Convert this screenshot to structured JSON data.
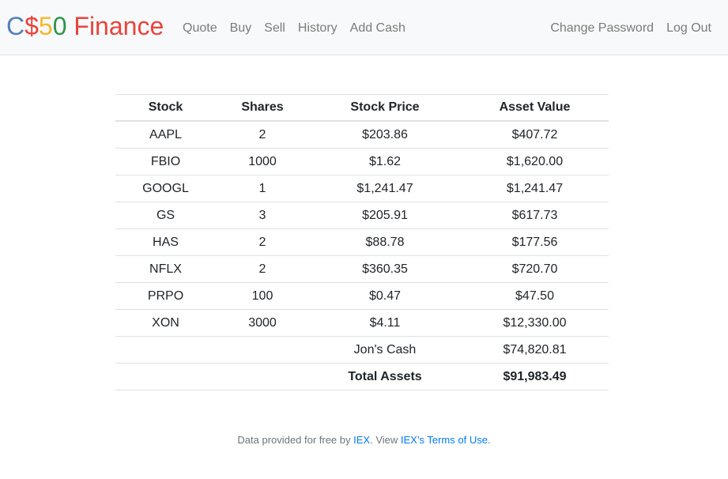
{
  "brand": {
    "parts": [
      {
        "text": "C",
        "color": "#537fbe"
      },
      {
        "text": "$",
        "color": "#ea433b"
      },
      {
        "text": "5",
        "color": "#f5b82e"
      },
      {
        "text": "0",
        "color": "#2e944b"
      },
      {
        "text": " Finance",
        "color": "#ea433b"
      }
    ]
  },
  "nav": {
    "left": [
      "Quote",
      "Buy",
      "Sell",
      "History",
      "Add Cash"
    ],
    "right": [
      "Change Password",
      "Log Out"
    ]
  },
  "table": {
    "headers": [
      "Stock",
      "Shares",
      "Stock Price",
      "Asset Value"
    ],
    "rows": [
      [
        "AAPL",
        "2",
        "$203.86",
        "$407.72"
      ],
      [
        "FBIO",
        "1000",
        "$1.62",
        "$1,620.00"
      ],
      [
        "GOOGL",
        "1",
        "$1,241.47",
        "$1,241.47"
      ],
      [
        "GS",
        "3",
        "$205.91",
        "$617.73"
      ],
      [
        "HAS",
        "2",
        "$88.78",
        "$177.56"
      ],
      [
        "NFLX",
        "2",
        "$360.35",
        "$720.70"
      ],
      [
        "PRPO",
        "100",
        "$0.47",
        "$47.50"
      ],
      [
        "XON",
        "3000",
        "$4.11",
        "$12,330.00"
      ]
    ],
    "cash_label": "Jon's Cash",
    "cash_value": "$74,820.81",
    "total_label": "Total Assets",
    "total_value": "$91,983.49"
  },
  "footer": {
    "prefix": "Data provided for free by ",
    "iex_link": "IEX",
    "middle": ". View ",
    "terms_link": "IEX’s Terms of Use",
    "suffix": "."
  }
}
